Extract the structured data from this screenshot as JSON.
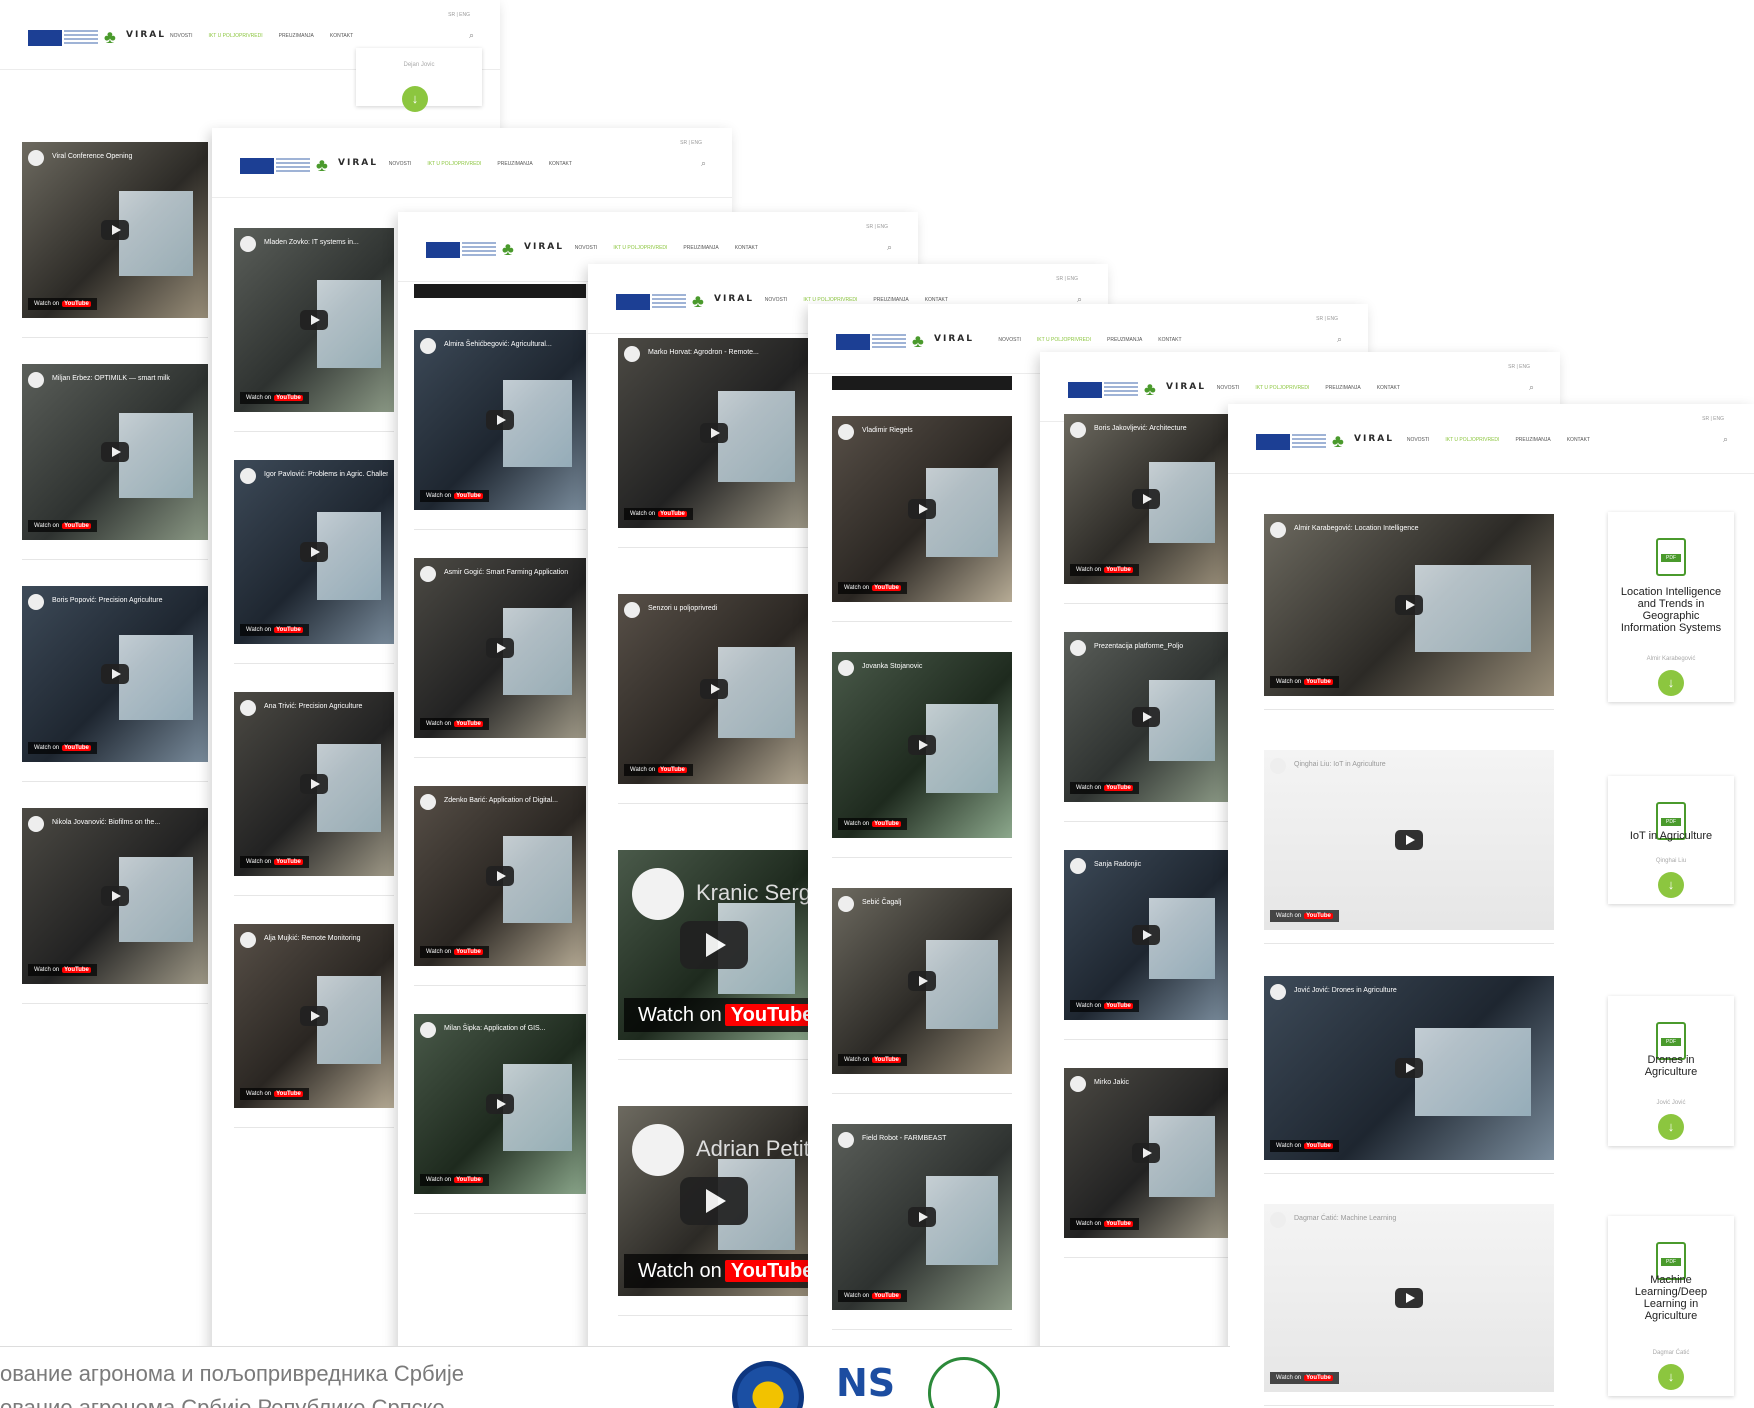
{
  "header": {
    "logo_text": "VIRAL",
    "nav_items": [
      "NOVOSTI",
      "IKT U POLJOPRIVREDI",
      "PREUZIMANJA",
      "KONTAKT"
    ],
    "lang": "SR | ENG"
  },
  "screens": [
    {
      "videos": [
        "Viral Conference Opening",
        "Miljan Erbez: OPTIMILK — smart milk",
        "Boris Popović: Precision Agriculture",
        "Nikola Jovanović: Biofilms on the..."
      ]
    },
    {
      "videos": [
        "Mladen Zovko: IT systems in...",
        "Igor Pavlović: Problems in Agric. Challenges",
        "Ana Trivić: Precision Agriculture",
        "Alja Mujkić: Remote Monitoring"
      ]
    },
    {
      "videos": [
        "Almira Šehićbegović: Agricultural...",
        "Asmir Gogić: Smart Farming Application",
        "Zdenko Barić: Application of Digital...",
        "Milan Šipka: Application of GIS..."
      ]
    },
    {
      "videos": [
        "Marko Horvat: Agrodron - Remote...",
        "Senzori u poljoprivredi",
        "Kranic Sergej",
        "Adrian Petit"
      ]
    },
    {
      "videos": [
        "Vladimir Riegels",
        "Jovanka Stojanovic",
        "Sebić Čagalj",
        "Field Robot - FARMBEAST"
      ]
    },
    {
      "videos": [
        "",
        "Boris Jakovljević: Architecture",
        "Prezentacija platforme_Poljo",
        "Sanja Radonjic",
        "Mirko Jakic"
      ]
    },
    {
      "videos": [
        "Almir Karabegović: Location Intelligence",
        "Qinghai Liu: IoT in Agriculture",
        "Jović Jović: Drones in Agriculture",
        "Dagmar Ćatić: Machine Learning"
      ],
      "docs": [
        {
          "title": "Location Intelligence and Trends in Geographic Information Systems",
          "author": "Almir Karabegović"
        },
        {
          "title": "IoT in Agriculture",
          "author": "Qinghai Liu"
        },
        {
          "title": "Drones in Agriculture",
          "author": "Jović Jović"
        },
        {
          "title": "Machine Learning/Deep Learning in Agriculture",
          "author": "Dagmar Ćatić"
        }
      ]
    }
  ],
  "big_video": {
    "watch_label": "Watch on",
    "brand": "YouTube"
  },
  "small_watch_label": "Watch on",
  "small_brand": "YouTube",
  "footer": {
    "line1": "ование агронома и пољопривредника Србије",
    "line2": "ование агронома Србије Републике Српске"
  },
  "top_card_author": "Dejan Jovic"
}
